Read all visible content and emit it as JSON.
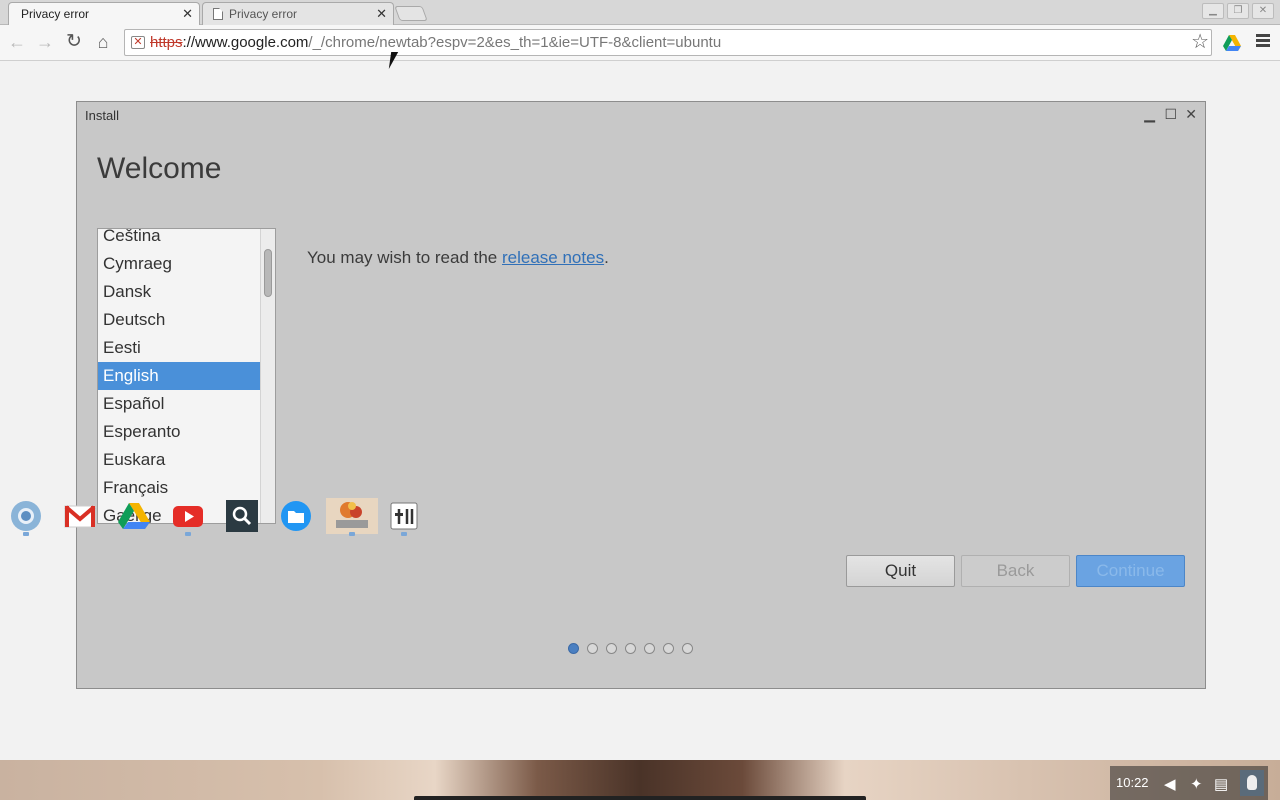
{
  "browser": {
    "tabs": [
      {
        "title": "Privacy error",
        "active": true
      },
      {
        "title": "Privacy error",
        "active": false
      }
    ],
    "address_bar": {
      "scheme": "https",
      "host": "://www.google.com",
      "path": "/_/chrome/newtab?espv=2&es_th=1&ie=UTF-8&client=ubuntu",
      "security": "not-secure"
    },
    "icons": {
      "back": "arrow-left-icon",
      "forward": "arrow-right-icon",
      "reload": "reload-icon",
      "home": "home-icon",
      "bookmark": "star-icon",
      "extension": "google-drive-icon",
      "menu": "hamburger-menu-icon"
    }
  },
  "installer": {
    "window_title": "Install",
    "heading": "Welcome",
    "languages": [
      "Čeština",
      "Cymraeg",
      "Dansk",
      "Deutsch",
      "Eesti",
      "English",
      "Español",
      "Esperanto",
      "Euskara",
      "Français",
      "Gaeilge"
    ],
    "selected_language": "English",
    "release_text": "You may wish to read the ",
    "release_link": "release notes",
    "release_suffix": ".",
    "buttons": {
      "quit": "Quit",
      "back": "Back",
      "continue": "Continue"
    },
    "steps": {
      "total": 7,
      "current": 1
    }
  },
  "launcher": {
    "apps": [
      {
        "name": "chrome-app-icon",
        "running": true
      },
      {
        "name": "gmail-icon",
        "running": false
      },
      {
        "name": "google-drive-icon",
        "running": false
      },
      {
        "name": "youtube-icon",
        "running": true
      },
      {
        "name": "search-icon",
        "running": false
      },
      {
        "name": "files-icon",
        "running": false
      },
      {
        "name": "installer-app-icon",
        "running": true
      },
      {
        "name": "terminal-settings-icon",
        "running": true
      }
    ]
  },
  "system_tray": {
    "time": "10:22",
    "icons": [
      "volume-muted-icon",
      "network-icon",
      "notification-icon",
      "user-avatar"
    ]
  },
  "colors": {
    "selection": "#4a90d9",
    "continue_button": "#6aa3e2",
    "link": "#3070b8"
  }
}
